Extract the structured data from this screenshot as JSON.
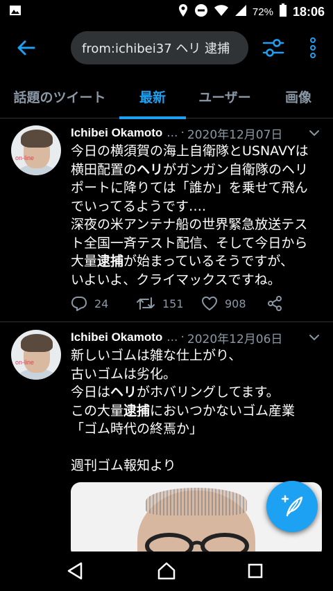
{
  "status_bar": {
    "battery": "72%",
    "time": "18:06",
    "icons": [
      "image-icon",
      "location-icon",
      "dnd-icon",
      "wifi-icon",
      "signal-icon",
      "battery-icon"
    ]
  },
  "search": {
    "query": "from:ichibei37 ヘリ 逮捕"
  },
  "tabs": [
    {
      "label": "話題のツイート",
      "active": false
    },
    {
      "label": "最新",
      "active": true
    },
    {
      "label": "ユーザー",
      "active": false
    },
    {
      "label": "画像",
      "active": false
    }
  ],
  "tweets": [
    {
      "name": "Ichibei Okamoto",
      "ellipsis": "...",
      "dot": "·",
      "date": "2020年12月07日",
      "avatar_badge": "on-line",
      "lines": [
        [
          {
            "t": "今日の横須賀の海上自衛隊とUSNAVYは"
          }
        ],
        [
          {
            "t": "横田配置の"
          },
          {
            "t": "ヘリ",
            "b": true
          },
          {
            "t": "がガンガン自衛隊のヘリ"
          }
        ],
        [
          {
            "t": "ポートに降りては「誰か」を乗せて飛ん"
          }
        ],
        [
          {
            "t": "でいってるようです…."
          }
        ],
        [
          {
            "t": "深夜の米アンテナ船の世界緊急放送テス"
          }
        ],
        [
          {
            "t": "ト全国一斉テスト配信、そして今日から"
          }
        ],
        [
          {
            "t": "大量"
          },
          {
            "t": "逮捕",
            "b": true
          },
          {
            "t": "が始まっているそうですが、"
          }
        ],
        [
          {
            "t": "いよいよ、クライマックスですね。"
          }
        ]
      ],
      "replies": "24",
      "retweets": "151",
      "likes": "908"
    },
    {
      "name": "Ichibei Okamoto",
      "ellipsis": "...",
      "dot": "·",
      "date": "2020年12月06日",
      "avatar_badge": "on-line",
      "lines": [
        [
          {
            "t": "新しいゴムは雑な仕上がり、"
          }
        ],
        [
          {
            "t": "古いゴムは劣化。"
          }
        ],
        [
          {
            "t": "今日は"
          },
          {
            "t": "ヘリ",
            "b": true
          },
          {
            "t": "がホバリングしてます。"
          }
        ],
        [
          {
            "t": "この大量"
          },
          {
            "t": "逮捕",
            "b": true
          },
          {
            "t": "においつかないゴム産業"
          }
        ],
        [
          {
            "t": "「ゴム時代の終焉か」"
          }
        ],
        [
          {
            "t": ""
          }
        ],
        [
          {
            "t": "週刊ゴム報知より"
          }
        ]
      ]
    }
  ],
  "colors": {
    "accent": "#1da1f2",
    "muted": "#8b98a5",
    "background": "#000000",
    "divider": "#2f3336"
  }
}
